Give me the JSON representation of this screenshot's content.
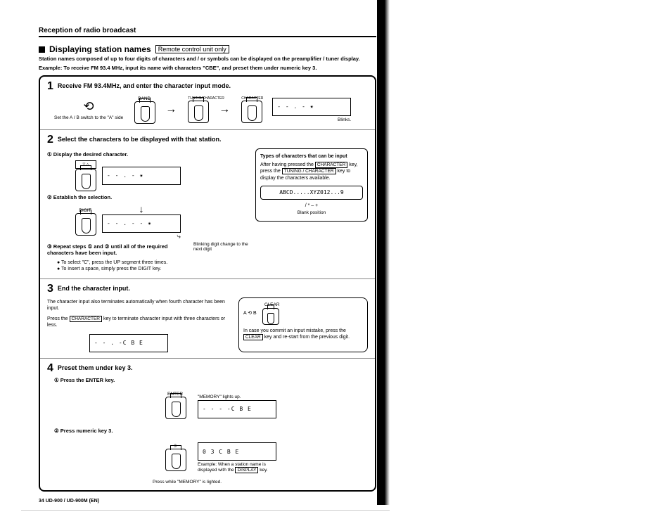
{
  "header": "Reception of radio broadcast",
  "title": "Displaying station names",
  "tag": "Remote control unit only",
  "intro": "Station names composed of up to four digits of characters and / or symbols can be displayed on the preamplifier / tuner display.",
  "example": "Example: To receive FM 93.4 MHz, input its name with characters \"CBE\", and preset them under numeric key 3.",
  "step1": {
    "title": "Receive FM 93.4MHz, and enter the character input mode.",
    "sw_cap": "Set the A / B switch to the \"A\" side",
    "band": "BAND",
    "tc": "TUNING/CHARACTER",
    "char": "CHARACTER",
    "blinks": "Blinks."
  },
  "step2": {
    "title": "Select the characters to be displayed with that station.",
    "s1": "① Display the desired character.",
    "s2": "② Establish the selection.",
    "s3": "③ Repeat steps ① and ② until all of the required characters have been input.",
    "blink_note": "Blinking digit change to the next digit",
    "bul1": "● To select \"C\", press the UP segment three times.",
    "bul2": "● To insert a space, simply press the DIGIT key.",
    "types_h": "Types of characters that can be input",
    "types_t1": "After having pressed the",
    "types_k1": "CHARACTER",
    "types_t2": "key, press the",
    "types_k2": "TUNING / CHARACTER",
    "types_t3": "key to display the characters available.",
    "chars": "ABCD.....XYZ012...9",
    "sym": "/ * – +",
    "blank": "Blank position"
  },
  "step3": {
    "title": "End the character input.",
    "t1": "The character input also terminates automatically when fourth character has been input.",
    "t2a": "Press the",
    "t2k": "CHARACTER",
    "t2b": "key to terminate character input with three characters or less.",
    "disp": "C B E",
    "r1": "In case you commit an input mistake, press the",
    "rk": "CLEAR",
    "r2": "key and re-start from the previous digit."
  },
  "step4": {
    "title": "Preset them under key 3.",
    "s1": "① Press the ENTER key.",
    "s2": "② Press numeric key 3.",
    "mem": "\"MEMORY\" lights up.",
    "press": "Press while \"MEMORY\" is lighted.",
    "disp1": "C B E",
    "disp2": "0 3        C B E",
    "ex": "Example: When a station name is displayed with the",
    "exk": "DISPLAY",
    "ex2": "key."
  },
  "footer": "34 UD-900 / UD-900M (EN)"
}
